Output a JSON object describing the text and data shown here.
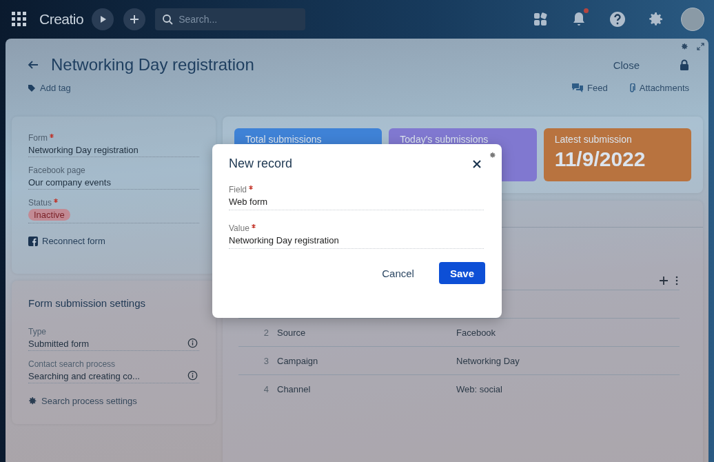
{
  "top_bar": {
    "logo": "Creatio",
    "search": {
      "placeholder": "Search..."
    },
    "notification_badge": true
  },
  "page": {
    "title": "Networking Day registration",
    "close_label": "Close",
    "add_tag": "Add tag",
    "feed": "Feed",
    "attachments": "Attachments"
  },
  "form_card": {
    "fields": [
      {
        "label": "Form",
        "required": true,
        "value": "Networking Day registration",
        "kind": "text"
      },
      {
        "label": "Facebook page",
        "required": false,
        "value": "Our company events",
        "kind": "text"
      },
      {
        "label": "Status",
        "required": true,
        "value": "Inactive",
        "kind": "tag"
      }
    ],
    "link": "Reconnect form"
  },
  "settings_card": {
    "title": "Form submission settings",
    "fields": [
      {
        "label": "Type",
        "required": false,
        "value": "Submitted form",
        "kind": "info"
      },
      {
        "label": "Contact search process",
        "required": false,
        "value": "Searching and creating co...",
        "kind": "info"
      }
    ],
    "link": "Search process settings"
  },
  "stats": [
    {
      "title": "Total submissions",
      "color": "#3f82d6"
    },
    {
      "title": "Today's submissions",
      "color": "#8078d0"
    },
    {
      "title": "Latest submission",
      "value": "11/9/2022",
      "color": "#b8733f"
    }
  ],
  "table": {
    "rows": [
      {
        "number": "2",
        "name": "Source",
        "value": "Facebook"
      },
      {
        "number": "3",
        "name": "Campaign",
        "value": "Networking Day"
      },
      {
        "number": "4",
        "name": "Channel",
        "value": "Web: social"
      }
    ]
  },
  "modal": {
    "title": "New record",
    "fields": [
      {
        "label": "Field",
        "required": true,
        "value": "Web form"
      },
      {
        "label": "Value",
        "required": true,
        "value": "Networking Day registration"
      }
    ],
    "buttons": [
      {
        "label": "Cancel",
        "kind": "secondary"
      },
      {
        "label": "Save",
        "kind": "primary"
      }
    ]
  }
}
